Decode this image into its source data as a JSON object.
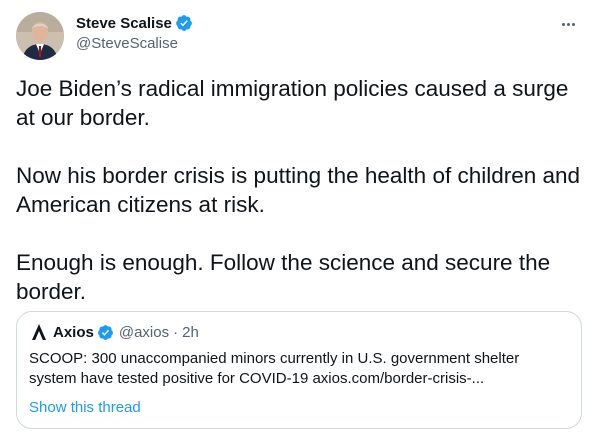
{
  "author": {
    "display_name": "Steve Scalise",
    "handle": "@SteveScalise",
    "avatar_icon": "profile-photo"
  },
  "tweet": {
    "paragraphs": [
      "Joe Biden’s radical immigration policies caused a surge at our border.",
      "Now his border crisis is putting the health of children and American citizens at risk.",
      "Enough is enough. Follow the science and secure the border."
    ]
  },
  "quote": {
    "name": "Axios",
    "handle": "@axios",
    "separator": "·",
    "time": "2h",
    "text": "SCOOP: 300 unaccompanied minors currently in U.S. government shelter system have tested positive for COVID-19 axios.com/border-crisis-...",
    "link_label": "Show this thread",
    "logo_icon": "axios-logo"
  },
  "colors": {
    "verified": "#1d9bf0",
    "link": "#1d9bf0",
    "secondary_text": "#536471",
    "border": "#cfd9de"
  },
  "icons": [
    "verified-badge-icon",
    "more-options-icon",
    "axios-logo-icon"
  ]
}
